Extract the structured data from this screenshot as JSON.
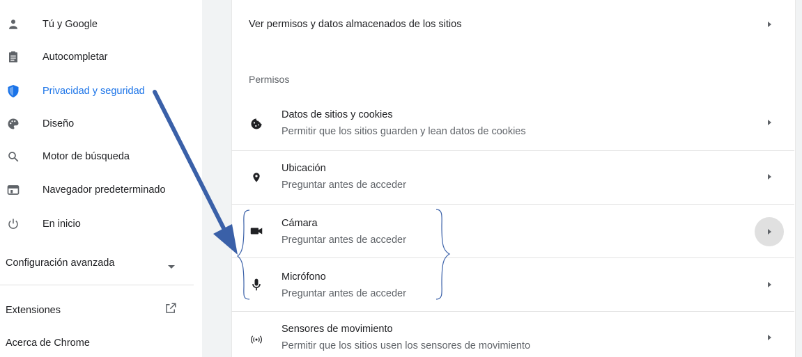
{
  "sidebar": {
    "items": [
      {
        "label": "Tú y Google",
        "icon": "person-icon"
      },
      {
        "label": "Autocompletar",
        "icon": "clipboard-icon"
      },
      {
        "label": "Privacidad y seguridad",
        "icon": "shield-icon",
        "active": true
      },
      {
        "label": "Diseño",
        "icon": "palette-icon"
      },
      {
        "label": "Motor de búsqueda",
        "icon": "search-icon"
      },
      {
        "label": "Navegador predeterminado",
        "icon": "browser-icon"
      },
      {
        "label": "En inicio",
        "icon": "power-icon"
      }
    ],
    "advanced": {
      "label": "Configuración avanzada"
    },
    "extensions": {
      "label": "Extensiones"
    },
    "about": {
      "label": "Acerca de Chrome"
    }
  },
  "main": {
    "site_settings_link": "Ver permisos y datos almacenados de los sitios",
    "permissions_heading": "Permisos",
    "permissions": [
      {
        "title": "Datos de sitios y cookies",
        "subtitle": "Permitir que los sitios guarden y lean datos de cookies",
        "icon": "cookie-icon"
      },
      {
        "title": "Ubicación",
        "subtitle": "Preguntar antes de acceder",
        "icon": "location-pin-icon"
      },
      {
        "title": "Cámara",
        "subtitle": "Preguntar antes de acceder",
        "icon": "camera-icon"
      },
      {
        "title": "Micrófono",
        "subtitle": "Preguntar antes de acceder",
        "icon": "microphone-icon"
      },
      {
        "title": "Sensores de movimiento",
        "subtitle": "Permitir que los sitios usen los sensores de movimiento",
        "icon": "motion-sensor-icon"
      }
    ]
  },
  "colors": {
    "accent": "#1a73e8",
    "annotation_arrow": "#3a60a8",
    "text": "#202124",
    "secondary_text": "#5f6368"
  }
}
